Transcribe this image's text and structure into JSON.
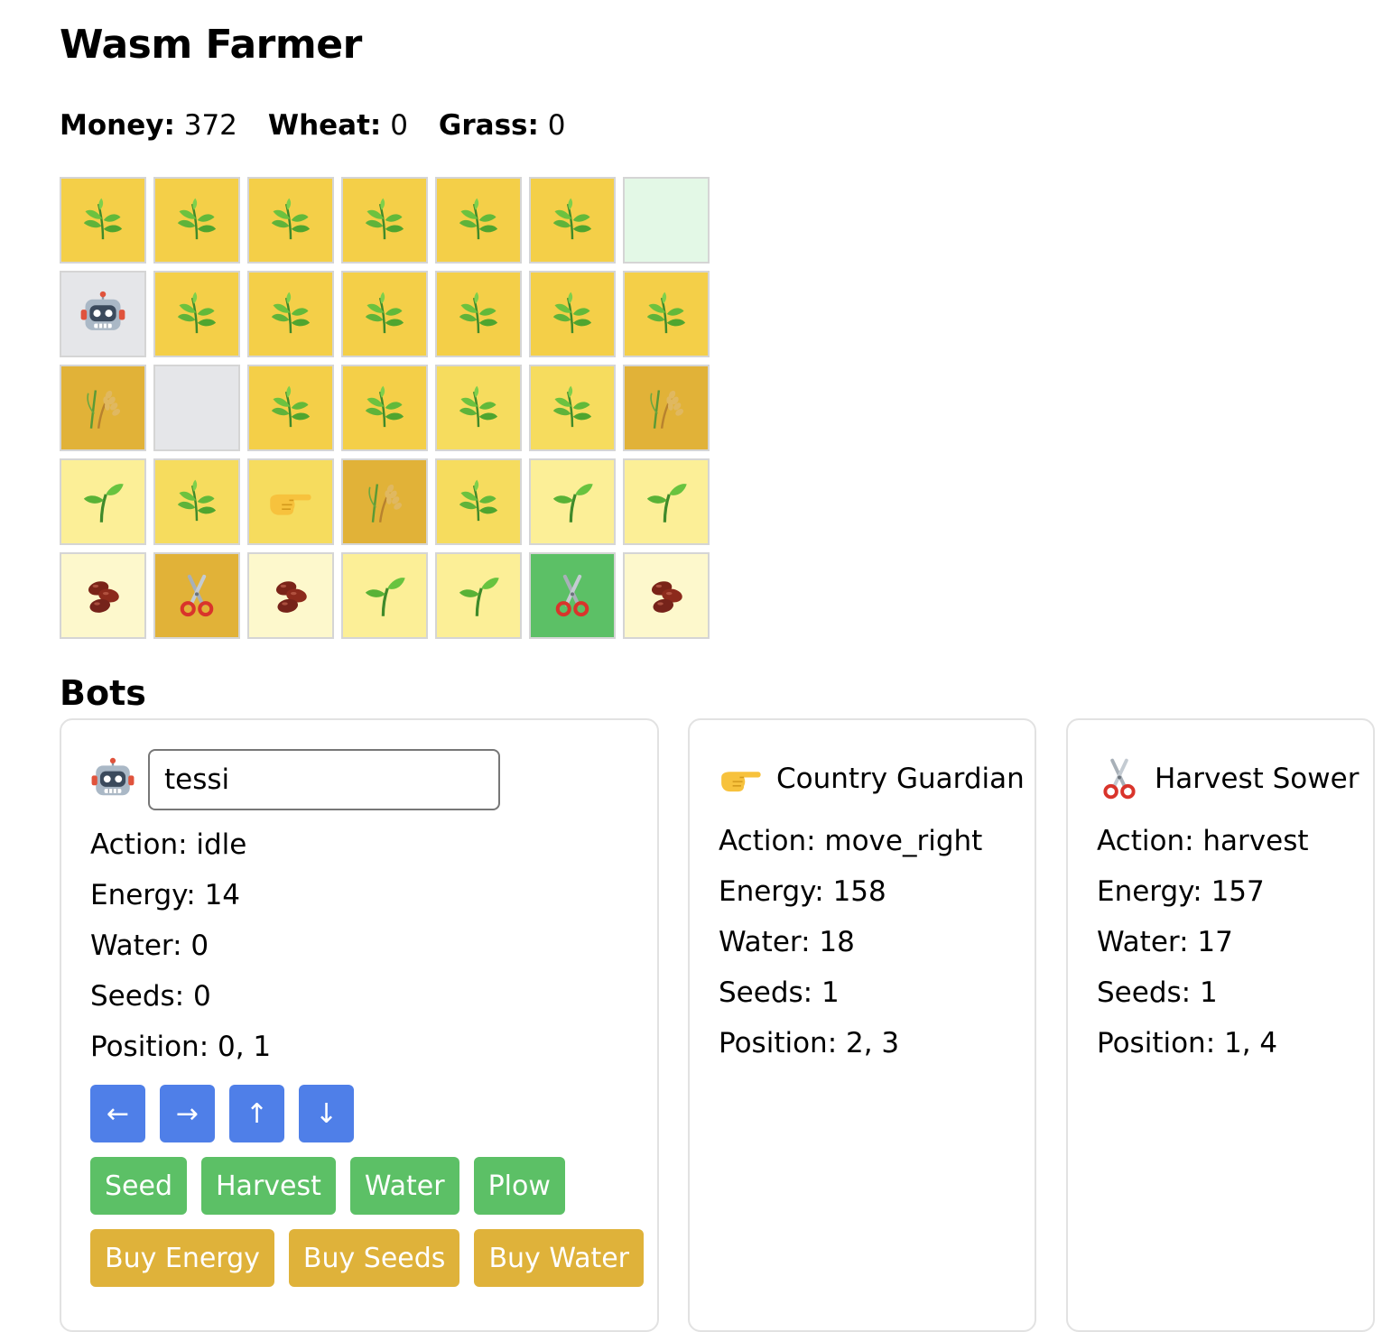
{
  "app": {
    "title": "Wasm Farmer"
  },
  "stats": {
    "money_label": "Money:",
    "money": "372",
    "wheat_label": "Wheat:",
    "wheat": "0",
    "grass_label": "Grass:",
    "grass": "0"
  },
  "colors": {
    "wheat": "#f4cf48",
    "sprout": "#fcef97",
    "seeded": "#fdf8cc",
    "ripe": "#e1b238",
    "empty": "#e5e6e9",
    "grass": "#e3f8e6",
    "bot_active": "#5cc066"
  },
  "grid": [
    [
      {
        "icon": "leafy-plant-icon",
        "bg": "#f4cf48"
      },
      {
        "icon": "leafy-plant-icon",
        "bg": "#f4cf48"
      },
      {
        "icon": "leafy-plant-icon",
        "bg": "#f4cf48"
      },
      {
        "icon": "leafy-plant-icon",
        "bg": "#f4cf48"
      },
      {
        "icon": "leafy-plant-icon",
        "bg": "#f4cf48"
      },
      {
        "icon": "leafy-plant-icon",
        "bg": "#f4cf48"
      },
      {
        "icon": "",
        "bg": "#e3f8e6"
      }
    ],
    [
      {
        "icon": "robot-icon",
        "bg": "#e5e6e9"
      },
      {
        "icon": "leafy-plant-icon",
        "bg": "#f4cf48"
      },
      {
        "icon": "leafy-plant-icon",
        "bg": "#f4cf48"
      },
      {
        "icon": "leafy-plant-icon",
        "bg": "#f4cf48"
      },
      {
        "icon": "leafy-plant-icon",
        "bg": "#f4cf48"
      },
      {
        "icon": "leafy-plant-icon",
        "bg": "#f4cf48"
      },
      {
        "icon": "leafy-plant-icon",
        "bg": "#f4cf48"
      }
    ],
    [
      {
        "icon": "wheat-sheaf-icon",
        "bg": "#e1b238"
      },
      {
        "icon": "",
        "bg": "#e5e6e9"
      },
      {
        "icon": "leafy-plant-icon",
        "bg": "#f4cf48"
      },
      {
        "icon": "leafy-plant-icon",
        "bg": "#f4cf48"
      },
      {
        "icon": "leafy-plant-icon",
        "bg": "#f6dc5e"
      },
      {
        "icon": "leafy-plant-icon",
        "bg": "#f6dc5e"
      },
      {
        "icon": "wheat-sheaf-icon",
        "bg": "#e1b238"
      }
    ],
    [
      {
        "icon": "seedling-icon",
        "bg": "#fcef97"
      },
      {
        "icon": "leafy-plant-icon",
        "bg": "#f6dc5e"
      },
      {
        "icon": "pointing-hand-icon",
        "bg": "#f6dc5e"
      },
      {
        "icon": "wheat-sheaf-icon",
        "bg": "#e1b238"
      },
      {
        "icon": "leafy-plant-icon",
        "bg": "#f6dc5e"
      },
      {
        "icon": "seedling-icon",
        "bg": "#fcef97"
      },
      {
        "icon": "seedling-icon",
        "bg": "#fcef97"
      }
    ],
    [
      {
        "icon": "beans-icon",
        "bg": "#fdf8cc"
      },
      {
        "icon": "scissors-icon",
        "bg": "#e1b238"
      },
      {
        "icon": "beans-icon",
        "bg": "#fdf8cc"
      },
      {
        "icon": "seedling-icon",
        "bg": "#fcef97"
      },
      {
        "icon": "seedling-icon",
        "bg": "#fcef97"
      },
      {
        "icon": "scissors-icon",
        "bg": "#5cc066"
      },
      {
        "icon": "beans-icon",
        "bg": "#fdf8cc"
      }
    ]
  ],
  "bots_heading": "Bots",
  "bots": [
    {
      "icon": "robot-icon",
      "name": "tessi",
      "action": "Action: idle",
      "energy": "Energy: 14",
      "water": "Water: 0",
      "seeds": "Seeds: 0",
      "position": "Position: 0, 1"
    },
    {
      "icon": "pointing-hand-icon",
      "name": "Country Guardian",
      "action": "Action: move_right",
      "energy": "Energy: 158",
      "water": "Water: 18",
      "seeds": "Seeds: 1",
      "position": "Position: 2, 3"
    },
    {
      "icon": "scissors-icon",
      "name": "Harvest Sower",
      "action": "Action: harvest",
      "energy": "Energy: 157",
      "water": "Water: 17",
      "seeds": "Seeds: 1",
      "position": "Position: 1, 4"
    }
  ],
  "controls": {
    "move": [
      "←",
      "→",
      "↑",
      "↓"
    ],
    "actions": [
      "Seed",
      "Harvest",
      "Water",
      "Plow"
    ],
    "buy": [
      "Buy Energy",
      "Buy Seeds",
      "Buy Water"
    ]
  }
}
